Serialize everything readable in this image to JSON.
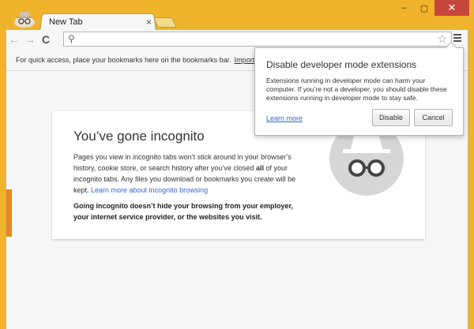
{
  "browser": {
    "tab_title": "New Tab",
    "tab_close": "×",
    "window_controls": {
      "minimize": "–",
      "maximize": "▢",
      "close": "✕"
    }
  },
  "toolbar": {
    "back": "←",
    "forward": "→",
    "reload": "C",
    "omnibox_placeholder": "",
    "search_icon": "search-icon",
    "star_icon": "star-icon"
  },
  "bookmarks_bar": {
    "text": "For quick access, place your bookmarks here on the bookmarks bar.",
    "import_link": "Import b"
  },
  "incognito_page": {
    "title": "You’ve gone incognito",
    "para_1": "Pages you view in incognito tabs won’t stick around in your browser’s history, cookie store, or search history after you’ve closed ",
    "para_all": "all",
    "para_2": " of your incognito tabs. Any files you download or bookmarks you create will be kept. ",
    "learn_more_link": "Learn more about incognito browsing",
    "bold_text": "Going incognito doesn’t hide your browsing from your employer, your internet service provider, or the websites you visit."
  },
  "dev_mode_bubble": {
    "title": "Disable developer mode extensions",
    "body": "Extensions running in developer mode can harm your computer. If you’re not a developer, you should disable these extensions running in developer mode to stay safe.",
    "learn_more": "Learn more",
    "disable_button": "Disable",
    "cancel_button": "Cancel"
  },
  "colors": {
    "frame": "#f0b32c",
    "close_button": "#c7463b",
    "link": "#3367d6",
    "incognito_icon_bg": "#d6d6d6"
  }
}
